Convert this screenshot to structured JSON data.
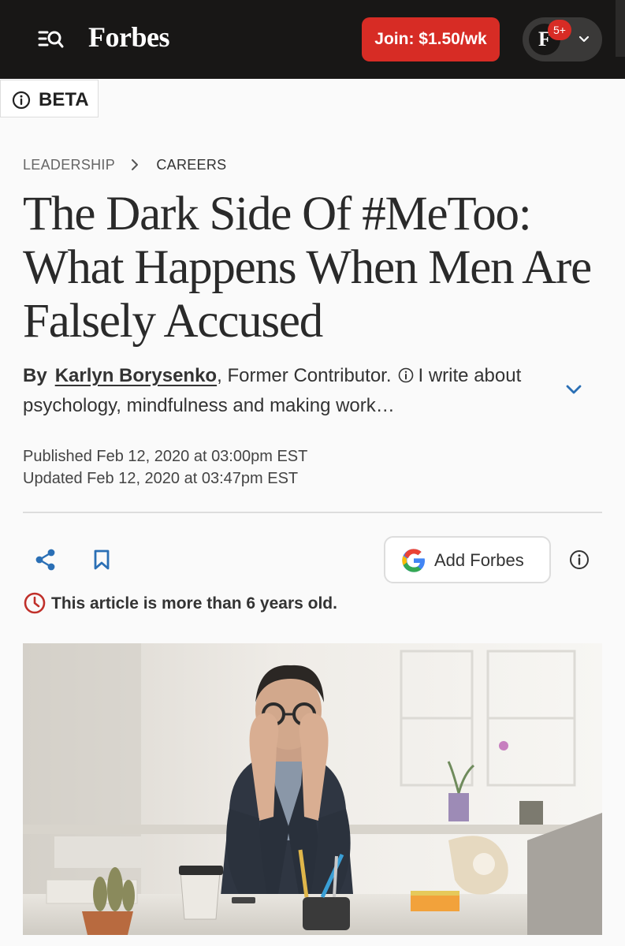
{
  "header": {
    "logo": "Forbes",
    "join_label": "Join: $1.50/wk",
    "avatar_letter": "F",
    "notification_count": "5+"
  },
  "beta": {
    "label": "BETA"
  },
  "breadcrumb": {
    "section": "LEADERSHIP",
    "subsection": "CAREERS"
  },
  "article": {
    "title": "The Dark Side Of #MeToo: What Happens When Men Are Falsely Accused",
    "byline_prefix": "By",
    "author": "Karlyn Borysenko",
    "author_role": "Former Contributor.",
    "author_bio": "I write about psychology, mindfulness and making work…",
    "published": "Published Feb 12, 2020 at 03:00pm EST",
    "updated": "Updated Feb 12, 2020 at 03:47pm EST",
    "age_notice": "This article is more than 6 years old."
  },
  "actions": {
    "add_forbes_label": "Add Forbes"
  },
  "colors": {
    "brand_red": "#d72c25",
    "link_blue": "#2a6fb5",
    "topbar": "#181716"
  },
  "icons": [
    "search-menu-icon",
    "chevron-down-icon",
    "info-icon",
    "chevron-right-icon",
    "share-icon",
    "bookmark-icon",
    "google-icon",
    "clock-icon"
  ]
}
